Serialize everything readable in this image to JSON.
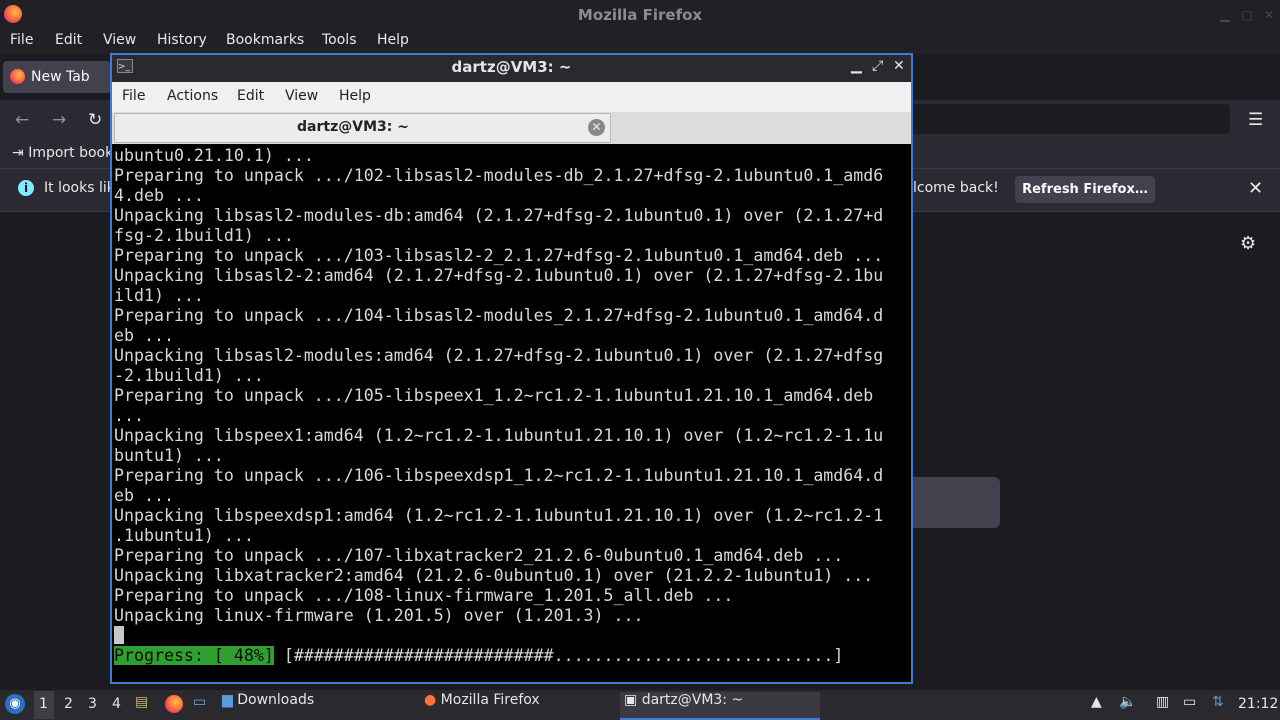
{
  "firefox": {
    "title": "Mozilla Firefox",
    "menu": [
      "File",
      "Edit",
      "View",
      "History",
      "Bookmarks",
      "Tools",
      "Help"
    ],
    "tab_label": "New Tab",
    "import_bookmarks": "Import book",
    "notice_text": "It looks lik",
    "notice_right": "lcome back!",
    "refresh_button": "Refresh Firefox…"
  },
  "terminal": {
    "title": "dartz@VM3: ~",
    "menu": [
      "File",
      "Actions",
      "Edit",
      "View",
      "Help"
    ],
    "tab_label": "dartz@VM3: ~",
    "lines": [
      "ubuntu0.21.10.1) ...",
      "Preparing to unpack .../102-libsasl2-modules-db_2.1.27+dfsg-2.1ubuntu0.1_amd6",
      "4.deb ...",
      "Unpacking libsasl2-modules-db:amd64 (2.1.27+dfsg-2.1ubuntu0.1) over (2.1.27+d",
      "fsg-2.1build1) ...",
      "Preparing to unpack .../103-libsasl2-2_2.1.27+dfsg-2.1ubuntu0.1_amd64.deb ...",
      "Unpacking libsasl2-2:amd64 (2.1.27+dfsg-2.1ubuntu0.1) over (2.1.27+dfsg-2.1bu",
      "ild1) ...",
      "Preparing to unpack .../104-libsasl2-modules_2.1.27+dfsg-2.1ubuntu0.1_amd64.d",
      "eb ...",
      "Unpacking libsasl2-modules:amd64 (2.1.27+dfsg-2.1ubuntu0.1) over (2.1.27+dfsg",
      "-2.1build1) ...",
      "Preparing to unpack .../105-libspeex1_1.2~rc1.2-1.1ubuntu1.21.10.1_amd64.deb",
      "...",
      "Unpacking libspeex1:amd64 (1.2~rc1.2-1.1ubuntu1.21.10.1) over (1.2~rc1.2-1.1u",
      "buntu1) ...",
      "Preparing to unpack .../106-libspeexdsp1_1.2~rc1.2-1.1ubuntu1.21.10.1_amd64.d",
      "eb ...",
      "Unpacking libspeexdsp1:amd64 (1.2~rc1.2-1.1ubuntu1.21.10.1) over (1.2~rc1.2-1",
      ".1ubuntu1) ...",
      "Preparing to unpack .../107-libxatracker2_21.2.6-0ubuntu0.1_amd64.deb ...",
      "Unpacking libxatracker2:amd64 (21.2.6-0ubuntu0.1) over (21.2.2-1ubuntu1) ...",
      "Preparing to unpack .../108-linux-firmware_1.201.5_all.deb ...",
      "Unpacking linux-firmware (1.201.5) over (1.201.3) ..."
    ],
    "progress_label": "Progress: [ 48%]",
    "progress_bar": " [##########################............................]",
    "progress_percent": 48
  },
  "taskbar": {
    "workspaces": [
      "1",
      "2",
      "3",
      "4"
    ],
    "apps": [
      "Downloads",
      "Mozilla Firefox",
      "dartz@VM3: ~"
    ],
    "clock": "21:12"
  }
}
